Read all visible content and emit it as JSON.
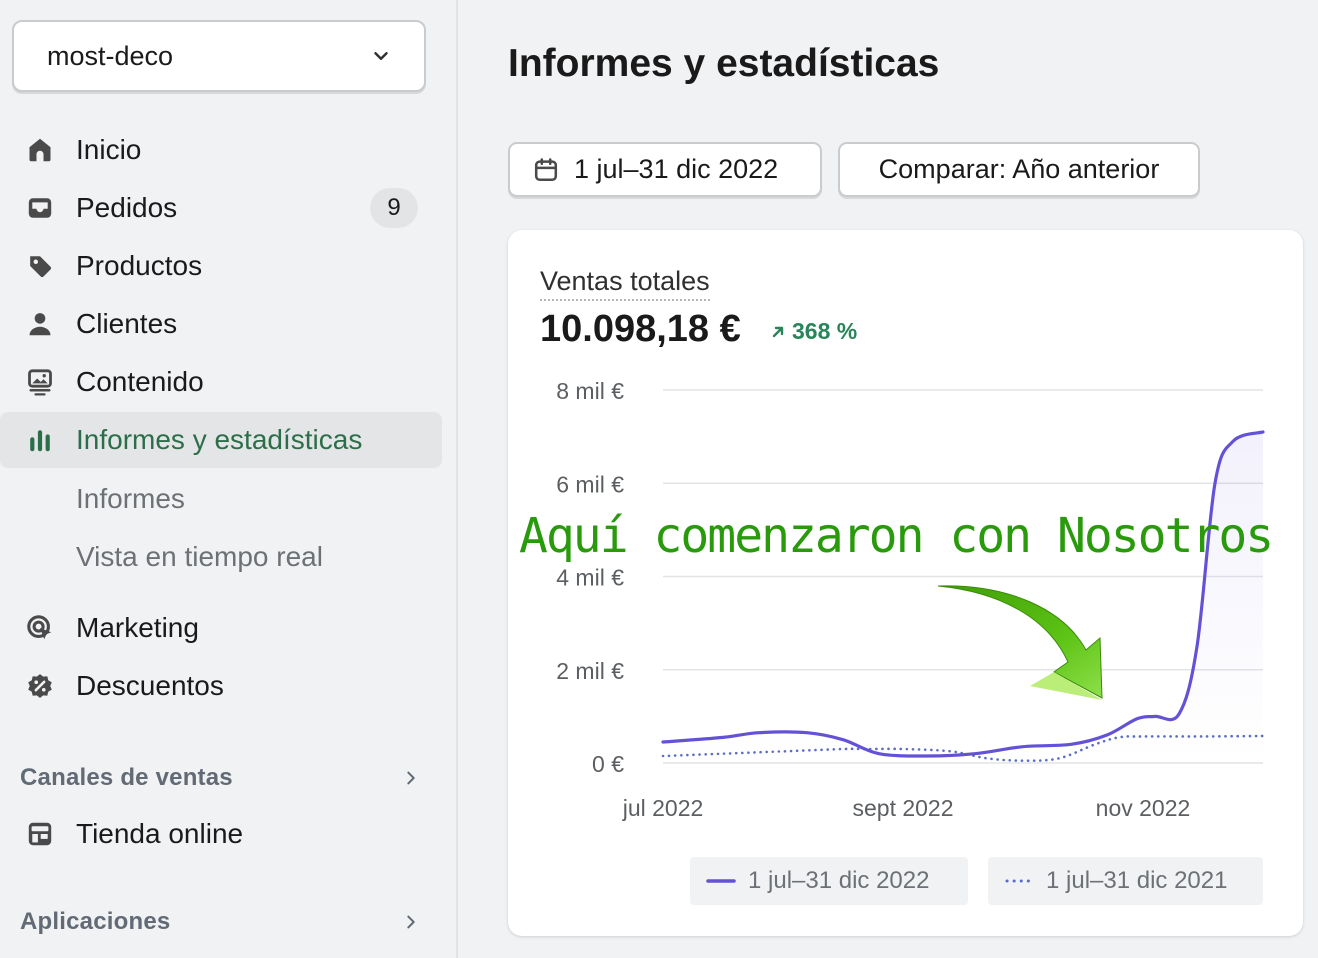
{
  "store": {
    "name": "most-deco",
    "icon": "chevron-down-icon"
  },
  "nav": {
    "items": [
      {
        "label": "Inicio",
        "icon": "home-icon"
      },
      {
        "label": "Pedidos",
        "icon": "inbox-icon",
        "badge": "9"
      },
      {
        "label": "Productos",
        "icon": "tag-icon"
      },
      {
        "label": "Clientes",
        "icon": "person-icon"
      },
      {
        "label": "Contenido",
        "icon": "image-icon"
      },
      {
        "label": "Informes y estadísticas",
        "icon": "bar-chart-icon",
        "active": true
      }
    ],
    "subitems": [
      {
        "label": "Informes"
      },
      {
        "label": "Vista en tiempo real"
      }
    ],
    "items2": [
      {
        "label": "Marketing",
        "icon": "target-icon"
      },
      {
        "label": "Descuentos",
        "icon": "discount-icon"
      }
    ],
    "sales_channels": {
      "label": "Canales de ventas",
      "items": [
        {
          "label": "Tienda online",
          "icon": "store-icon"
        }
      ]
    },
    "apps": {
      "label": "Aplicaciones"
    }
  },
  "page": {
    "title": "Informes y estadísticas",
    "date_button": "1 jul–31 dic 2022",
    "compare_button": "Comparar: Año anterior"
  },
  "card": {
    "label": "Ventas totales",
    "value": "10.098,18 €",
    "delta": "368 %",
    "delta_color": "#29845a"
  },
  "chart_data": {
    "type": "line",
    "ytick_labels": [
      "8 mil €",
      "6 mil €",
      "4 mil €",
      "2 mil €",
      "0 €"
    ],
    "yticks": [
      8000,
      6000,
      4000,
      2000,
      0
    ],
    "ylim": [
      0,
      8000
    ],
    "xtick_labels": [
      "jul 2022",
      "sept 2022",
      "nov 2022"
    ],
    "xticks": [
      0,
      2,
      4
    ],
    "xlim": [
      0,
      5
    ],
    "series": [
      {
        "name": "1 jul–31 dic 2022",
        "color": "#6452d6",
        "style": "solid",
        "x": [
          0,
          0.5,
          0.8,
          1.2,
          1.5,
          1.8,
          2.2,
          2.6,
          3.0,
          3.4,
          3.7,
          3.95,
          4.1,
          4.3,
          4.45,
          4.6,
          4.75,
          5.0
        ],
        "y": [
          450,
          550,
          650,
          650,
          500,
          200,
          150,
          200,
          350,
          400,
          600,
          950,
          1000,
          1050,
          2500,
          6000,
          6900,
          7100
        ]
      },
      {
        "name": "1 jul–31 dic 2021",
        "color": "#5b6ec4",
        "style": "dotted",
        "x": [
          0,
          0.5,
          1.0,
          1.5,
          1.7,
          2.0,
          2.4,
          2.7,
          3.0,
          3.3,
          3.6,
          3.8,
          4.0,
          4.5,
          5.0
        ],
        "y": [
          150,
          200,
          250,
          300,
          300,
          300,
          250,
          100,
          50,
          100,
          400,
          550,
          570,
          570,
          580
        ]
      }
    ]
  },
  "annotation": {
    "text": "Aquí comenzaron con Nosotros",
    "color": "#2a9a0d"
  }
}
